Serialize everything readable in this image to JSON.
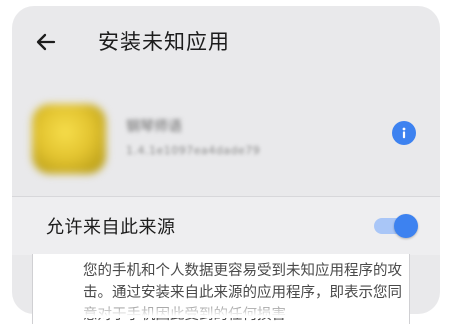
{
  "header": {
    "back_icon": "arrow-left-icon",
    "title": "安装未知应用"
  },
  "app": {
    "name": "钢琴师语",
    "version": "1.4.1e1097ea4dade79",
    "info_icon": "info-icon",
    "accent": "#3d82f0"
  },
  "permission": {
    "label": "允许来自此来源",
    "enabled": true
  },
  "warning": {
    "text": "您的手机和个人数据更容易受到未知应用程序的攻击。通过安装来自此来源的应用程序，即表示您同意对于手机因此受到的任何损害"
  }
}
